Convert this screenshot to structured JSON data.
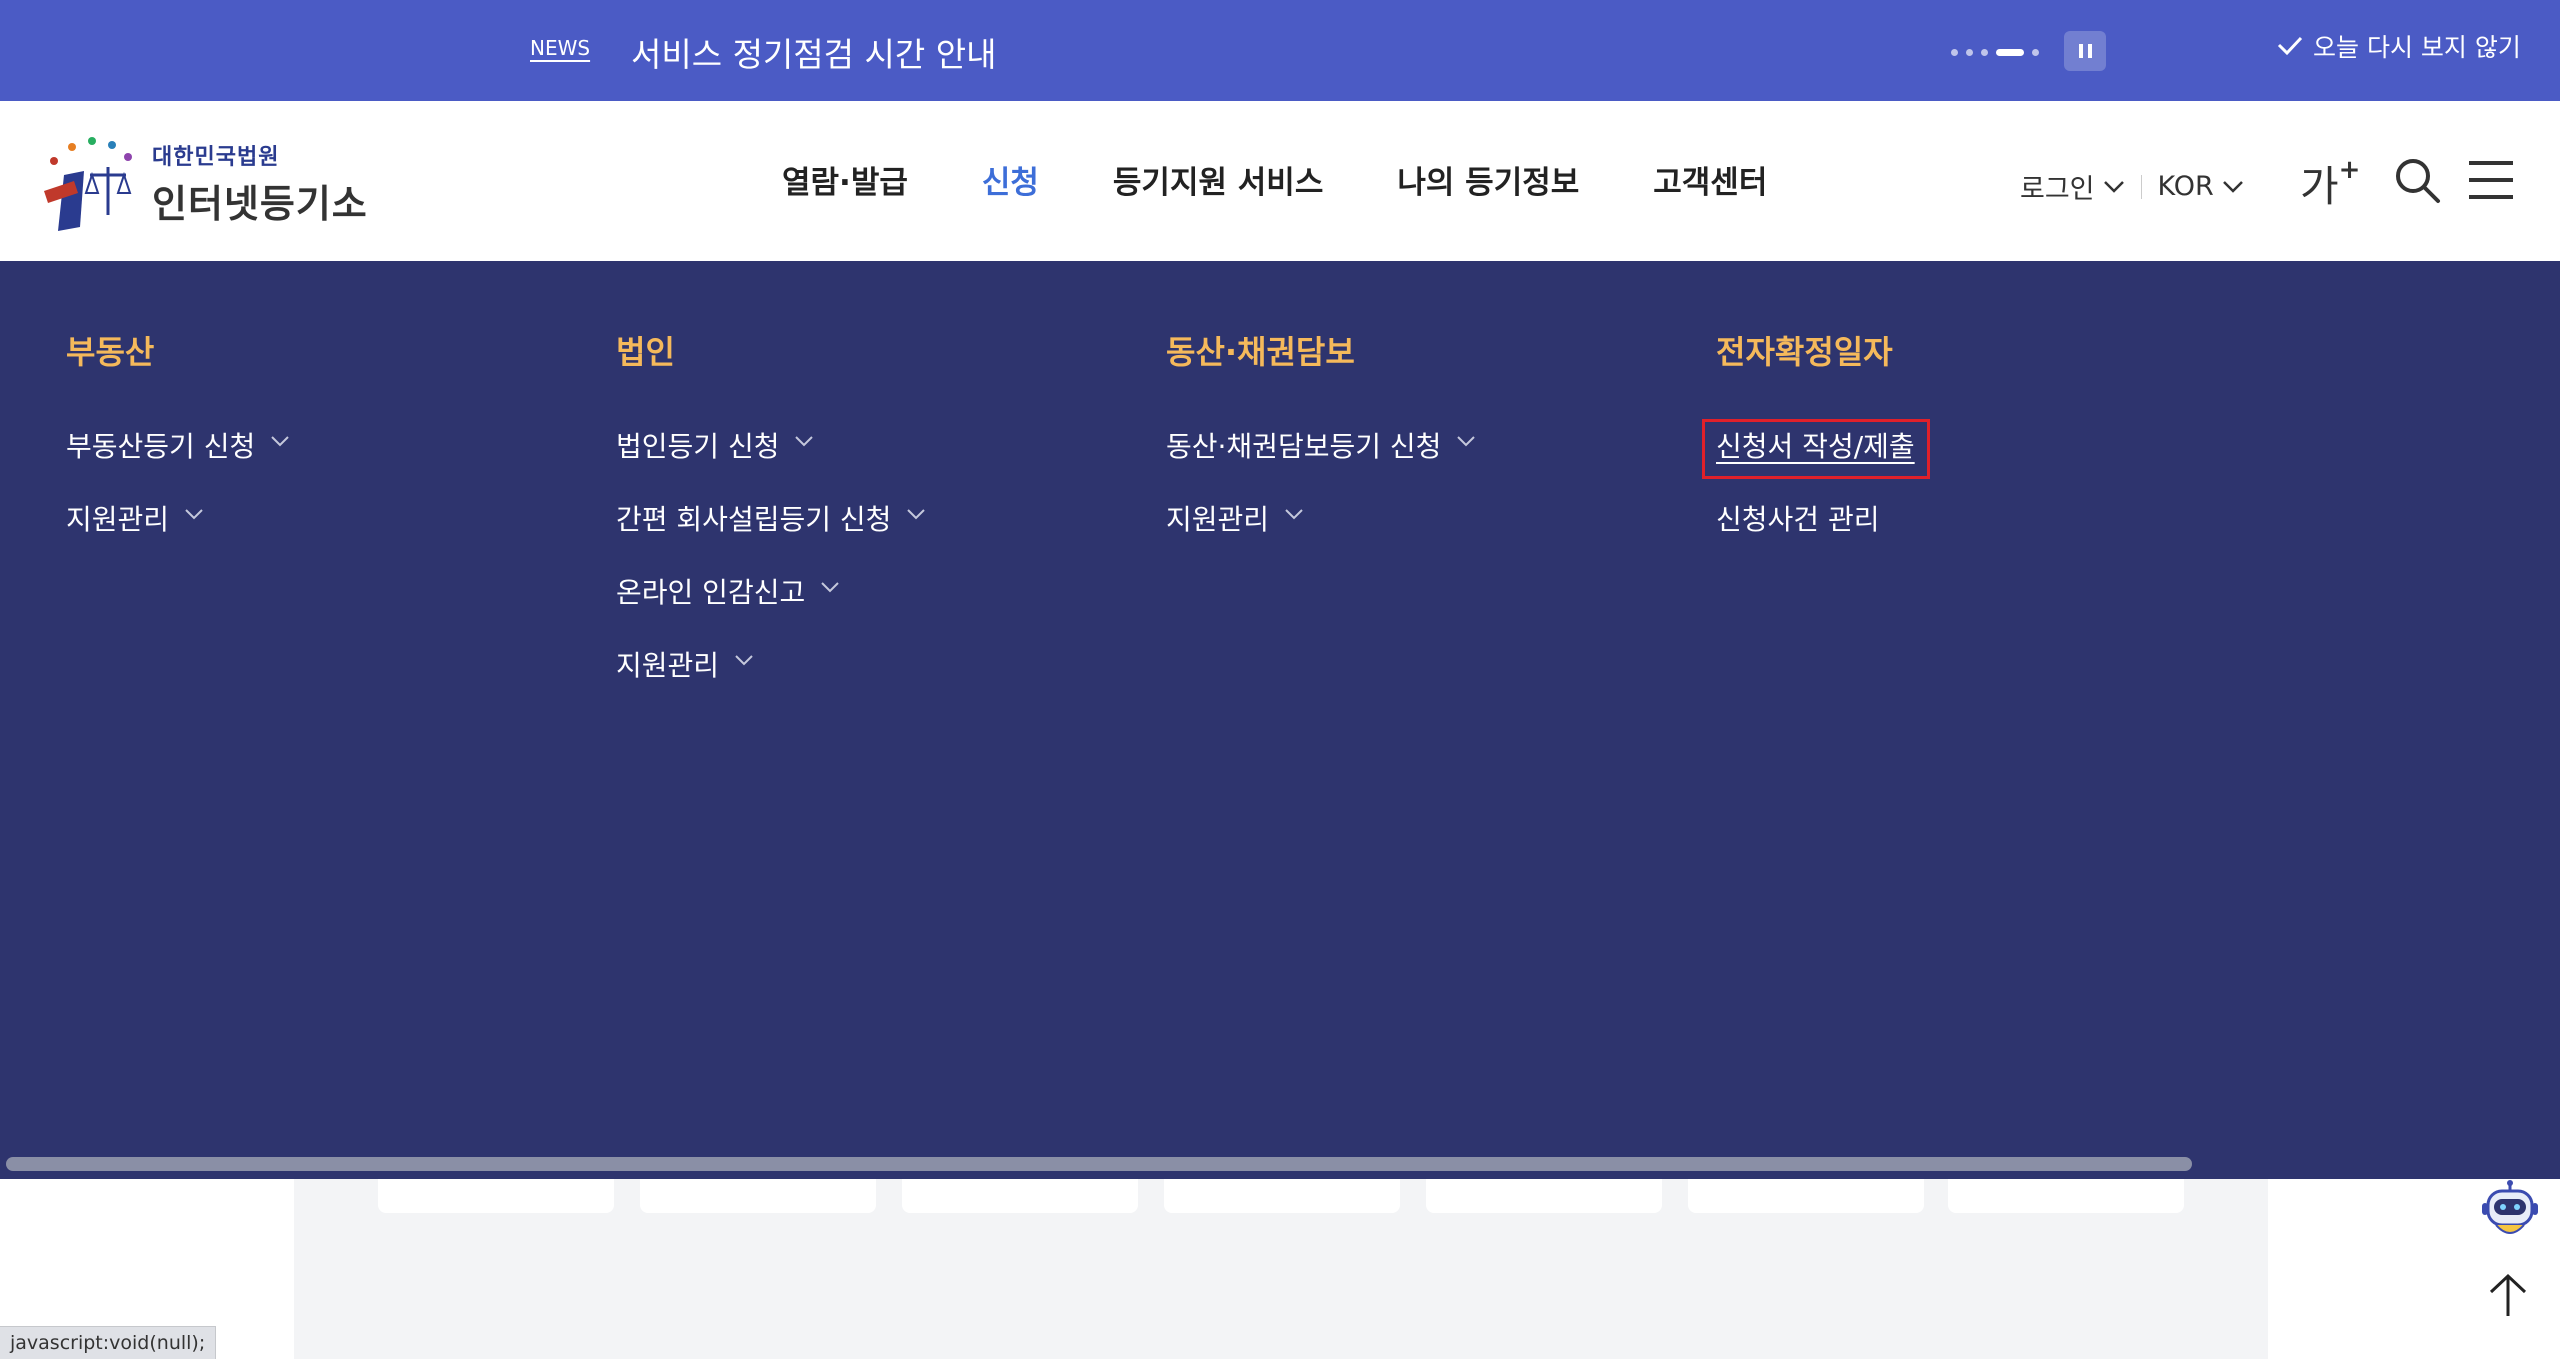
{
  "notice": {
    "tag": "NEWS",
    "text": "서비스 정기점검 시간 안내",
    "close_today_label": "오늘 다시 보지 않기"
  },
  "header": {
    "logo_sub": "대한민국법원",
    "logo_main": "인터넷등기소",
    "nav": [
      {
        "label": "열람·발급",
        "active": false
      },
      {
        "label": "신청",
        "active": true
      },
      {
        "label": "등기지원 서비스",
        "active": false
      },
      {
        "label": "나의 등기정보",
        "active": false
      },
      {
        "label": "고객센터",
        "active": false
      }
    ],
    "login_label": "로그인",
    "lang_label": "KOR",
    "font_size_label": "가",
    "font_size_plus": "+"
  },
  "mega_menu": {
    "columns": [
      {
        "title": "부동산",
        "items": [
          {
            "label": "부동산등기 신청",
            "has_sub": true
          },
          {
            "label": "지원관리",
            "has_sub": true
          }
        ]
      },
      {
        "title": "법인",
        "items": [
          {
            "label": "법인등기 신청",
            "has_sub": true
          },
          {
            "label": "간편 회사설립등기 신청",
            "has_sub": true
          },
          {
            "label": "온라인 인감신고",
            "has_sub": true
          },
          {
            "label": "지원관리",
            "has_sub": true
          }
        ]
      },
      {
        "title": "동산·채권담보",
        "items": [
          {
            "label": "동산·채권담보등기 신청",
            "has_sub": true
          },
          {
            "label": "지원관리",
            "has_sub": true
          }
        ]
      },
      {
        "title": "전자확정일자",
        "items": [
          {
            "label": "신청서 작성/제출",
            "has_sub": false,
            "highlight": true
          },
          {
            "label": "신청사건 관리",
            "has_sub": false
          }
        ]
      }
    ]
  },
  "status_bar": {
    "url": "javascript:void(null);"
  },
  "colors": {
    "notice_bg": "#4b5bc5",
    "mega_bg": "#2e346e",
    "category_title": "#f5b95b",
    "active_nav": "#3d6ed8",
    "highlight_box": "#e0202a"
  }
}
